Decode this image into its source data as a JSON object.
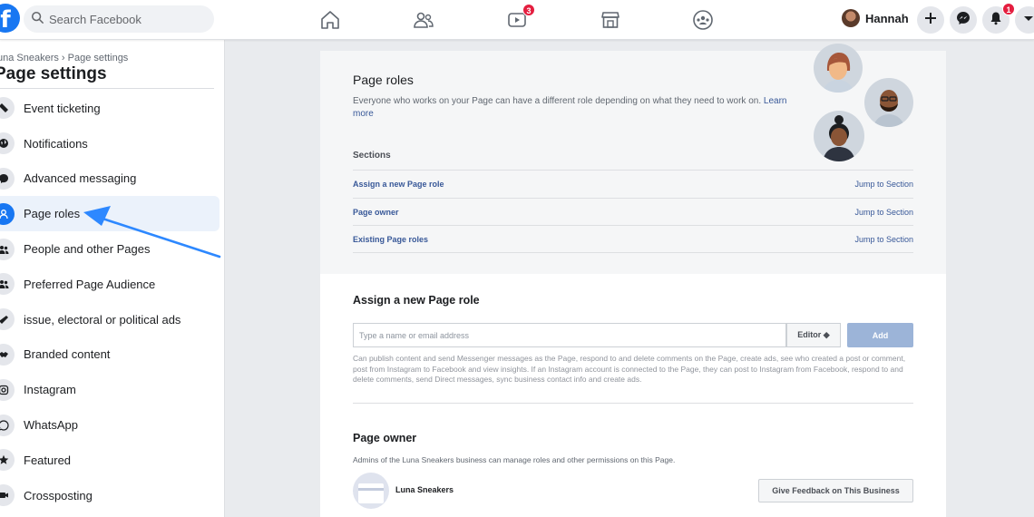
{
  "topbar": {
    "search_placeholder": "Search Facebook",
    "watch_badge": "3",
    "profile_name": "Hannah",
    "notifications_badge": "1"
  },
  "sidebar": {
    "breadcrumb": "una Sneakers › Page settings",
    "title": "Page settings",
    "items": [
      {
        "label": "Event ticketing",
        "icon": "ticket-icon"
      },
      {
        "label": "Notifications",
        "icon": "globe-icon"
      },
      {
        "label": "Advanced messaging",
        "icon": "messenger-icon"
      },
      {
        "label": "Page roles",
        "icon": "person-icon",
        "active": true
      },
      {
        "label": "People and other Pages",
        "icon": "people-icon"
      },
      {
        "label": "Preferred Page Audience",
        "icon": "people-icon"
      },
      {
        "label": "issue, electoral or political ads",
        "icon": "megaphone-icon"
      },
      {
        "label": "Branded content",
        "icon": "handshake-icon"
      },
      {
        "label": "Instagram",
        "icon": "instagram-icon"
      },
      {
        "label": "WhatsApp",
        "icon": "whatsapp-icon"
      },
      {
        "label": "Featured",
        "icon": "star-icon"
      },
      {
        "label": "Crossposting",
        "icon": "video-icon"
      }
    ]
  },
  "main": {
    "title": "Page roles",
    "description": "Everyone who works on your Page can have a different role depending on what they need to work on.",
    "learn_more": "Learn more",
    "sections_heading": "Sections",
    "sections": [
      {
        "name": "Assign a new Page role",
        "jump": "Jump to Section"
      },
      {
        "name": "Page owner",
        "jump": "Jump to Section"
      },
      {
        "name": "Existing Page roles",
        "jump": "Jump to Section"
      }
    ],
    "assign": {
      "heading": "Assign a new Page role",
      "input_placeholder": "Type a name or email address",
      "role_value": "Editor ◆",
      "add_label": "Add",
      "permissions": "Can publish content and send Messenger messages as the Page, respond to and delete comments on the Page, create ads, see who created a post or comment, post from Instagram to Facebook and view insights. If an Instagram account is connected to the Page, they can post to Instagram from Facebook, respond to and delete comments, send Direct messages, sync business contact info and create ads."
    },
    "owner": {
      "heading": "Page owner",
      "description": "Admins of the Luna Sneakers business can manage roles and other permissions on this Page.",
      "business_name": "Luna Sneakers",
      "feedback_label": "Give Feedback on This Business"
    }
  },
  "colors": {
    "accent": "#1877f2",
    "link": "#385898",
    "arrow": "#2d88ff",
    "badge": "#e41e3f"
  }
}
